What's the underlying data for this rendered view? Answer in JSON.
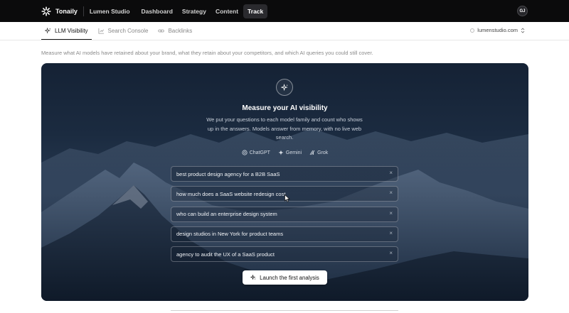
{
  "topbar": {
    "brand": "Tonaily",
    "workspace": "Lumen Studio",
    "nav": [
      {
        "label": "Dashboard",
        "active": false
      },
      {
        "label": "Strategy",
        "active": false
      },
      {
        "label": "Content",
        "active": false
      },
      {
        "label": "Track",
        "active": true
      }
    ],
    "avatar": "GJ"
  },
  "subnav": {
    "tabs": [
      {
        "label": "LLM Visibility",
        "icon": "sparkle-icon",
        "active": true
      },
      {
        "label": "Search Console",
        "icon": "chart-icon",
        "active": false
      },
      {
        "label": "Backlinks",
        "icon": "link-icon",
        "active": false
      }
    ],
    "domain": "lumenstudio.com"
  },
  "intro": "Measure what AI models have retained about your brand, what they retain about your competitors, and which AI queries you could still cover.",
  "hero": {
    "title": "Measure your AI visibility",
    "description": "We put your questions to each model family and count who shows up in the answers. Models answer from memory, with no live web search.",
    "models": [
      "ChatGPT",
      "Gemini",
      "Grok"
    ],
    "queries": [
      "best product design agency for a B2B SaaS",
      "how much does a SaaS website redesign cost",
      "who can build an enterprise design system",
      "design studios in New York for product teams",
      "agency to audit the UX of a SaaS product"
    ],
    "remove_glyph": "×",
    "launch_label": "Launch the first analysis"
  },
  "colors": {
    "topbar": "#0b0b0c",
    "hero_dark": "#152235",
    "accent_white": "#ffffff"
  }
}
